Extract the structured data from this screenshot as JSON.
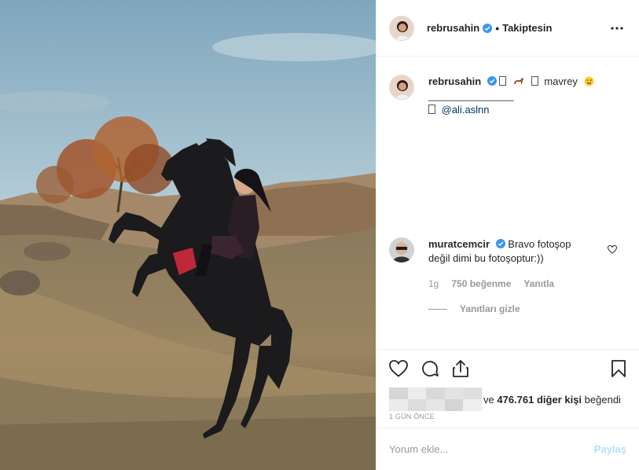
{
  "post": {
    "username": "rebrusahin",
    "separator": "•",
    "follow_state": "Takiptesin"
  },
  "caption": {
    "username": "rebrusahin",
    "text": "mavrey",
    "divider": "_______________",
    "mention": "@ali.aslnn"
  },
  "comment": {
    "username": "muratcemcir",
    "text": "Bravo fotoşop değil dimi bu fotoşoptur:))",
    "age": "1g",
    "likes": "750 beğenme",
    "reply_label": "Yanıtla",
    "hide_replies": "Yanıtları gizle"
  },
  "likes": {
    "prefix": "ve",
    "count": "476.761 diğer kişi",
    "suffix": "beğendi"
  },
  "timestamp": "1 GÜN ÖNCE",
  "add_comment": {
    "placeholder": "Yorum ekle...",
    "post_label": "Paylaş"
  },
  "colors": {
    "verified": "#3897f0",
    "sky_top": "#8fb3c6",
    "horse": "#1b1a1c",
    "post_disabled": "#b2dffc"
  }
}
